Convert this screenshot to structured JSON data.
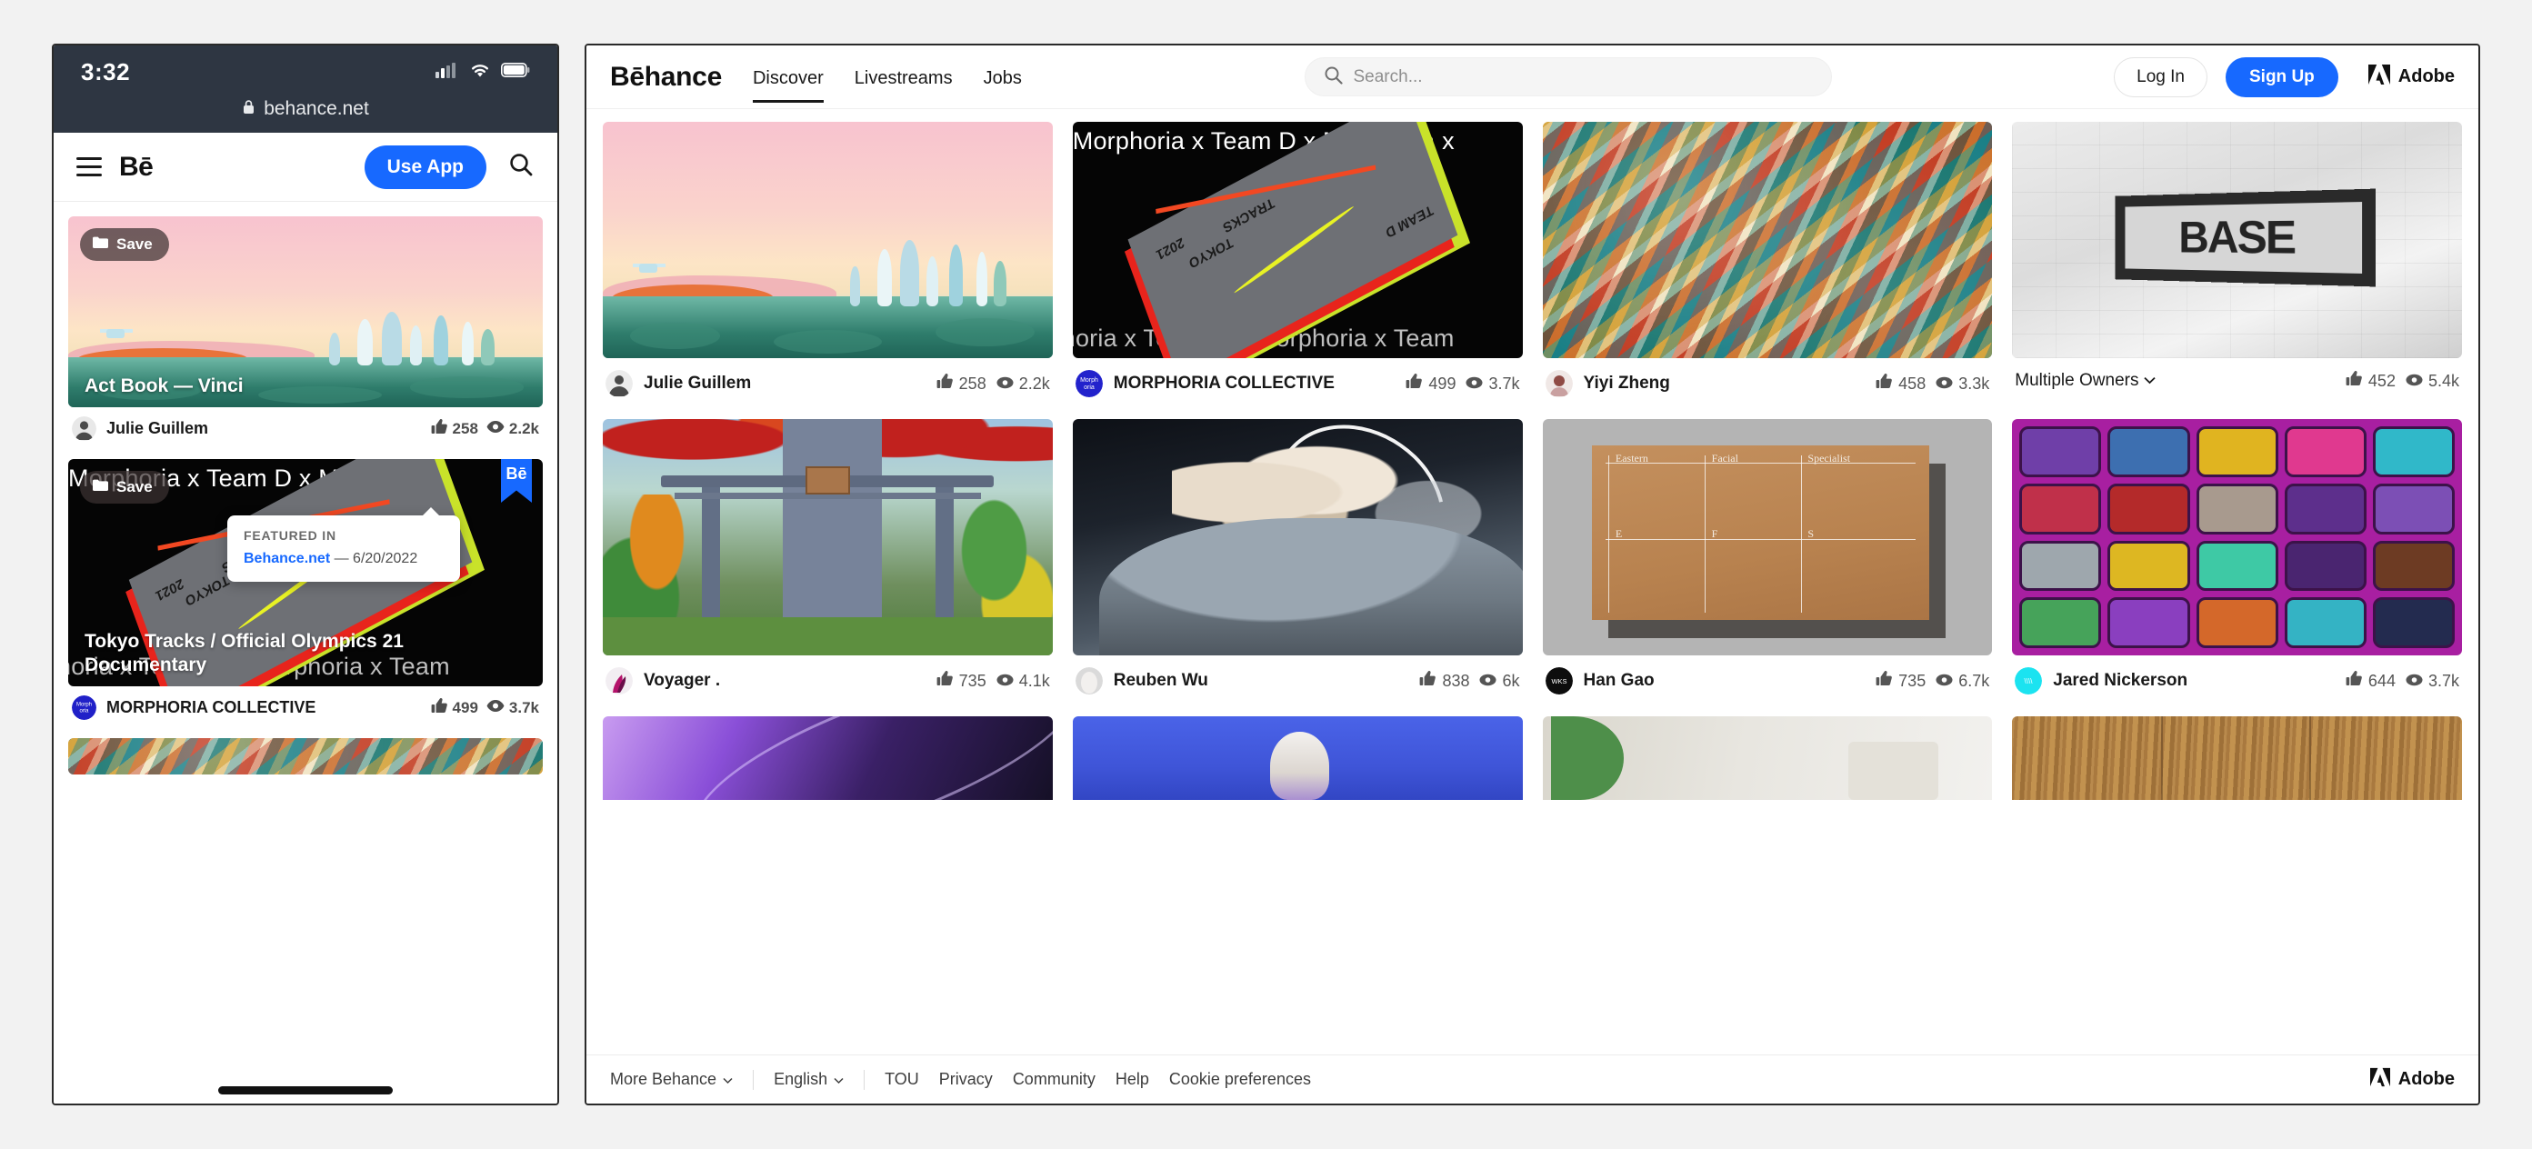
{
  "mobile": {
    "status": {
      "time": "3:32",
      "signal_icon": "cellular-signal-icon",
      "wifi_icon": "wifi-icon",
      "battery_icon": "battery-icon"
    },
    "url": "behance.net",
    "lock_icon": "lock-icon",
    "nav": {
      "menu_icon": "hamburger-menu-icon",
      "logo": "Bē",
      "use_app_label": "Use App",
      "search_icon": "search-icon"
    },
    "save_label": "Save",
    "cards": [
      {
        "title": "Act Book — Vinci",
        "owner": "Julie Guillem",
        "appreciations": "258",
        "views": "2.2k"
      },
      {
        "title": "Tokyo Tracks / Official Olympics 21 Documentary",
        "owner": "MORPHORIA COLLECTIVE",
        "appreciations": "499",
        "views": "3.7k",
        "ribbon_badge": "Bē",
        "tooltip": {
          "label": "FEATURED IN",
          "link": "Behance.net",
          "date": "— 6/20/2022"
        }
      }
    ]
  },
  "desktop": {
    "logo": "Bēhance",
    "nav": [
      {
        "label": "Discover",
        "active": true
      },
      {
        "label": "Livestreams",
        "active": false
      },
      {
        "label": "Jobs",
        "active": false
      }
    ],
    "search": {
      "placeholder": "Search...",
      "value": "",
      "icon": "search-icon"
    },
    "log_in_label": "Log In",
    "sign_up_label": "Sign Up",
    "adobe_label": "Adobe",
    "adobe_icon": "adobe-logo-icon",
    "cards": [
      {
        "owner": "Julie Guillem",
        "appreciations": "258",
        "views": "2.2k",
        "art": "vinci",
        "title": "",
        "dropdown": false
      },
      {
        "owner": "MORPHORIA COLLECTIVE",
        "appreciations": "499",
        "views": "3.7k",
        "art": "morphoria",
        "title": "Morphoria x Team D x Morphoria x",
        "title_bottom": "horia x Team D x Morphoria x Team",
        "dropdown": false
      },
      {
        "owner": "Yiyi Zheng",
        "appreciations": "458",
        "views": "3.3k",
        "art": "temple",
        "title": "",
        "dropdown": false
      },
      {
        "owner": "Multiple Owners",
        "appreciations": "452",
        "views": "5.4k",
        "art": "base",
        "title": "",
        "dropdown": true
      },
      {
        "owner": "Voyager .",
        "appreciations": "735",
        "views": "4.1k",
        "art": "torii",
        "title": "",
        "dropdown": false
      },
      {
        "owner": "Reuben Wu",
        "appreciations": "838",
        "views": "6k",
        "art": "cloudface",
        "title": "",
        "dropdown": false
      },
      {
        "owner": "Han Gao",
        "appreciations": "735",
        "views": "6.7k",
        "art": "box",
        "title": "",
        "dropdown": false
      },
      {
        "owner": "Jared Nickerson",
        "appreciations": "644",
        "views": "3.7k",
        "art": "stickers",
        "title": "",
        "dropdown": false
      }
    ],
    "partial_cards": [
      {
        "art": "purple"
      },
      {
        "art": "blue"
      },
      {
        "art": "plant"
      },
      {
        "art": "wood"
      }
    ],
    "footer": {
      "more_behance": "More Behance",
      "language": "English",
      "links": [
        "TOU",
        "Privacy",
        "Community",
        "Help",
        "Cookie preferences"
      ],
      "adobe_label": "Adobe"
    },
    "box_art_labels": {
      "c1": "Eastern",
      "c2": "Facial",
      "c3": "Specialist",
      "r1": "E",
      "r2": "F",
      "r3": "S"
    },
    "base_sign_text": "BASE",
    "book_text": {
      "a": "TOKYO",
      "b": "TRACKS",
      "c": "2021",
      "d": "TEAM D"
    }
  },
  "colors": {
    "accent_blue": "#1769ff",
    "text_dark": "#191919",
    "page_bg": "#f2f2f2",
    "status_bar": "#2e3642"
  }
}
